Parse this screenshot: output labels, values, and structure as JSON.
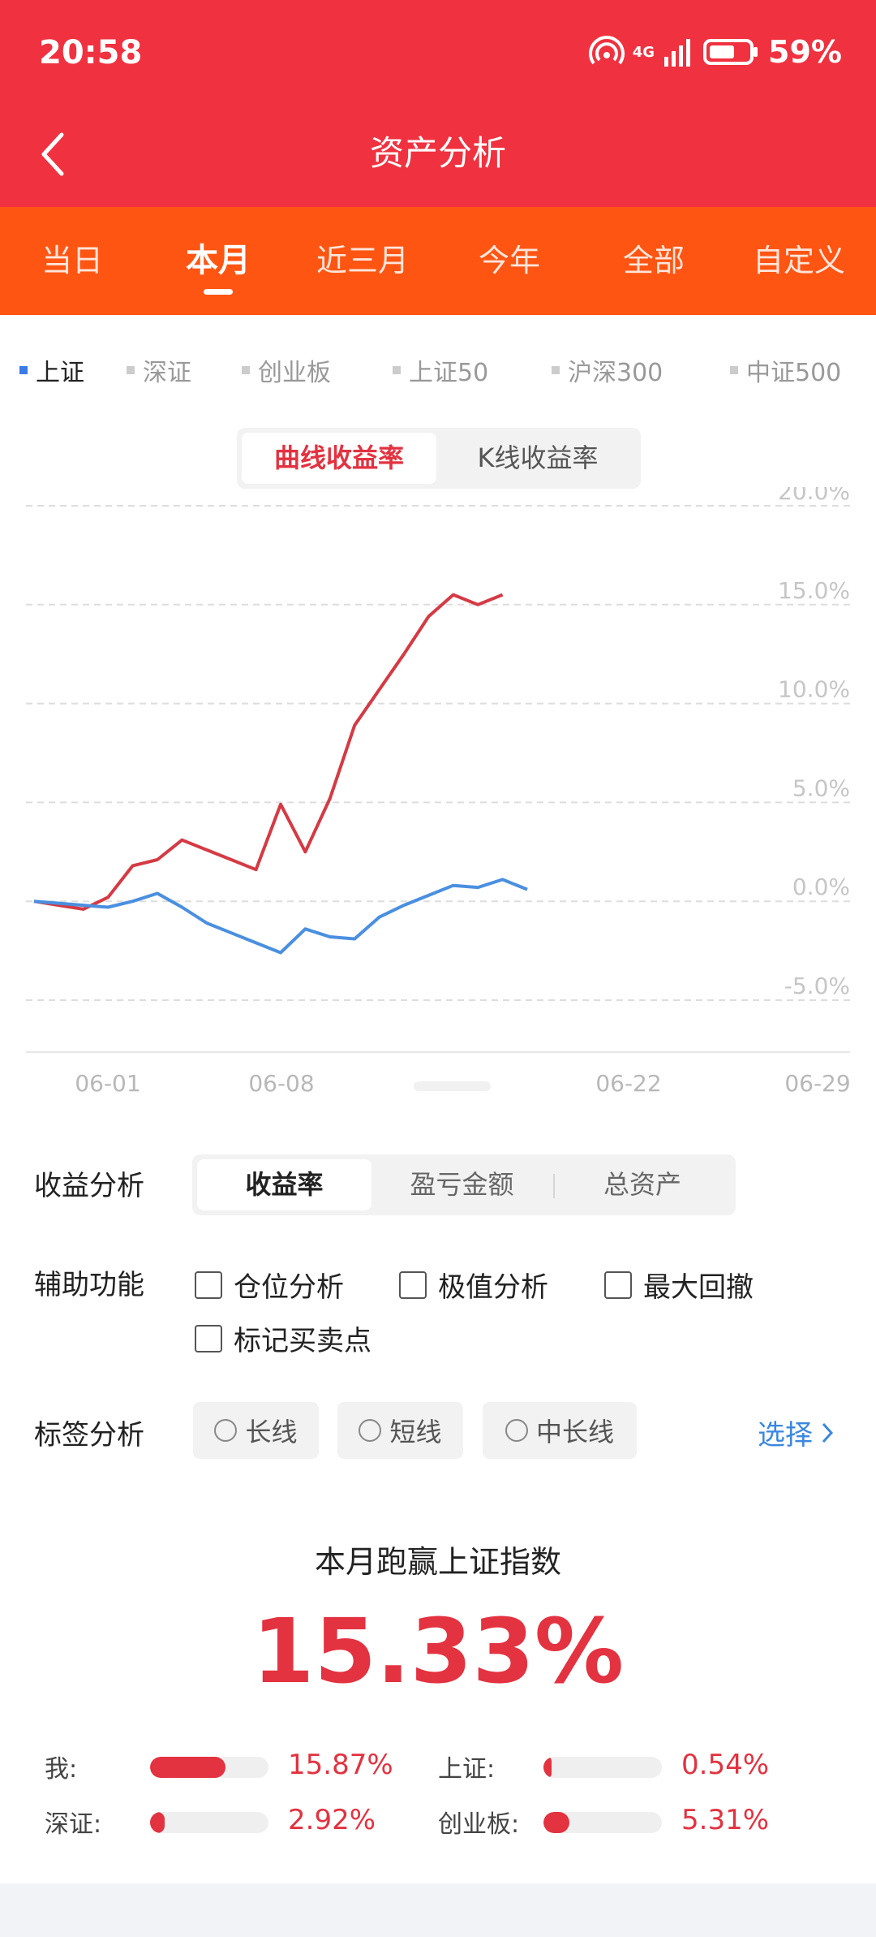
{
  "status_bar": {
    "time": "20:58",
    "signal": "4G",
    "battery": "59%"
  },
  "header": {
    "title": "资产分析",
    "back_icon": "chevron-left-icon"
  },
  "tabs": [
    {
      "label": "当日",
      "active": false
    },
    {
      "label": "本月",
      "active": true
    },
    {
      "label": "近三月",
      "active": false
    },
    {
      "label": "今年",
      "active": false
    },
    {
      "label": "全部",
      "active": false
    },
    {
      "label": "自定义",
      "active": false
    }
  ],
  "indices": [
    {
      "label": "上证",
      "active": true
    },
    {
      "label": "深证",
      "active": false
    },
    {
      "label": "创业板",
      "active": false
    },
    {
      "label": "上证50",
      "active": false
    },
    {
      "label": "沪深300",
      "active": false
    },
    {
      "label": "中证500",
      "active": false
    }
  ],
  "chart_mode": {
    "curve": "曲线收益率",
    "kline": "K线收益率",
    "selected": "curve"
  },
  "colors": {
    "brand_red": "#f0313f",
    "tab_orange": "#fe5512",
    "mine_line": "#d53a44",
    "index_line": "#4a8fe0",
    "link_blue": "#3b87e0"
  },
  "chart_data": {
    "type": "line",
    "y_ticks": [
      "20.0%",
      "15.0%",
      "10.0%",
      "5.0%",
      "0.0%",
      "-5.0%"
    ],
    "ylim": [
      -5,
      20
    ],
    "x_ticks": [
      "06-01",
      "06-08",
      "06-22",
      "06-29"
    ],
    "grid": true,
    "series": [
      {
        "color": "#d53a44",
        "values": [
          0.0,
          -0.2,
          -0.4,
          0.2,
          1.8,
          2.1,
          3.1,
          2.6,
          2.1,
          1.6,
          4.9,
          2.5,
          5.2,
          8.9,
          10.7,
          12.5,
          14.4,
          15.5,
          15.0,
          15.5
        ]
      },
      {
        "color": "#4a8fe0",
        "values": [
          0.0,
          -0.1,
          -0.2,
          -0.3,
          0.0,
          0.4,
          -0.3,
          -1.1,
          -1.6,
          -2.1,
          -2.6,
          -1.4,
          -1.8,
          -1.9,
          -0.8,
          -0.2,
          0.3,
          0.8,
          0.7,
          1.1,
          0.6
        ]
      }
    ]
  },
  "analysis": {
    "label": "收益分析",
    "options": [
      "收益率",
      "盈亏金额",
      "总资产"
    ],
    "selected": 0
  },
  "aux": {
    "label": "辅助功能",
    "options": [
      "仓位分析",
      "极值分析",
      "最大回撤",
      "标记买卖点"
    ]
  },
  "tags": {
    "label": "标签分析",
    "options": [
      "长线",
      "短线",
      "中长线"
    ],
    "choose": "选择"
  },
  "beat": {
    "title": "本月跑赢上证指数",
    "value": "15.33%"
  },
  "stats": [
    {
      "label": "我:",
      "value": "15.87%",
      "level": 0.64
    },
    {
      "label": "上证:",
      "value": "0.54%",
      "level": 0.03
    },
    {
      "label": "深证:",
      "value": "2.92%",
      "level": 0.12
    },
    {
      "label": "创业板:",
      "value": "5.31%",
      "level": 0.22
    }
  ]
}
